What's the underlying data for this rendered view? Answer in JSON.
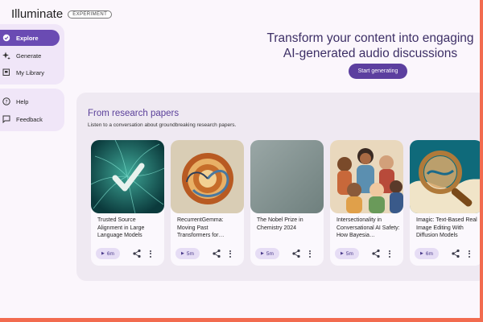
{
  "app": {
    "name": "Illuminate",
    "badge": "EXPERIMENT"
  },
  "nav": {
    "primary": [
      {
        "label": "Explore",
        "icon": "explore-icon",
        "active": true
      },
      {
        "label": "Generate",
        "icon": "sparkle-icon",
        "active": false
      },
      {
        "label": "My Library",
        "icon": "library-icon",
        "active": false
      }
    ],
    "secondary": [
      {
        "label": "Help",
        "icon": "help-icon"
      },
      {
        "label": "Feedback",
        "icon": "feedback-icon"
      }
    ]
  },
  "hero": {
    "title_line1": "Transform your content into engaging",
    "title_line2": "AI-generated audio discussions",
    "button": "Start generating"
  },
  "section": {
    "title": "From research papers",
    "subtitle": "Listen to a conversation about groundbreaking research papers.",
    "cards": [
      {
        "title": "Trusted Source Alignment in Large Language Models",
        "duration": "6m",
        "image": "green-checkmark-neurons"
      },
      {
        "title": "RecurrentGemma: Moving Past Transformers for…",
        "duration": "5m",
        "image": "orange-spiral-sculpture"
      },
      {
        "title": "The Nobel Prize in Chemistry 2024",
        "duration": "5m",
        "image": "gray-teal-gradient"
      },
      {
        "title": "Intersectionality in Conversational AI Safety: How Bayesia…",
        "duration": "5m",
        "image": "diverse-people-illustration"
      },
      {
        "title": "Imagic: Text-Based Real Image Editing With Diffusion Models",
        "duration": "6m",
        "image": "magnifying-glass-wave"
      }
    ]
  },
  "colors": {
    "accent": "#6a4bb3",
    "title": "#5a3f99",
    "frame": "#f26b4f"
  }
}
